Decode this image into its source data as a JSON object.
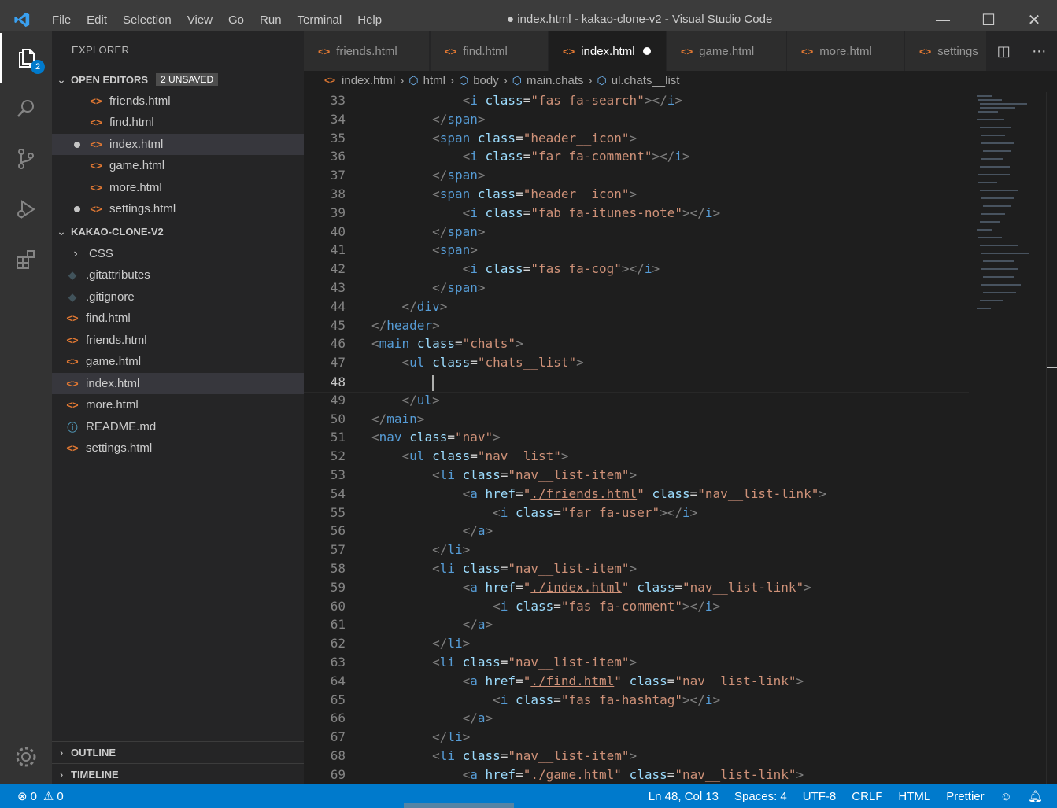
{
  "menu": [
    "File",
    "Edit",
    "Selection",
    "View",
    "Go",
    "Run",
    "Terminal",
    "Help"
  ],
  "window_title": "● index.html - kakao-clone-v2 - Visual Studio Code",
  "window_controls": {
    "minimize": "—",
    "maximize": "☐",
    "close": "✕"
  },
  "activity": {
    "explorer_badge": "2"
  },
  "explorer": {
    "title": "EXPLORER",
    "open_editors": {
      "label": "OPEN EDITORS",
      "badge": "2 UNSAVED",
      "files": [
        "friends.html",
        "find.html",
        "index.html",
        "game.html",
        "more.html",
        "settings.html"
      ]
    },
    "project": {
      "label": "KAKAO-CLONE-V2",
      "items": [
        "CSS",
        ".gitattributes",
        ".gitignore",
        "find.html",
        "friends.html",
        "game.html",
        "index.html",
        "more.html",
        "README.md",
        "settings.html"
      ]
    },
    "outline": "OUTLINE",
    "timeline": "TIMELINE"
  },
  "tabs": [
    "friends.html",
    "find.html",
    "index.html",
    "game.html",
    "more.html",
    "settings"
  ],
  "breadcrumb": [
    "index.html",
    "html",
    "body",
    "main.chats",
    "ul.chats__list"
  ],
  "status": {
    "errors": "0",
    "warnings": "0",
    "position": "Ln 48, Col 13",
    "spaces": "Spaces: 4",
    "encoding": "UTF-8",
    "eol": "CRLF",
    "language": "HTML",
    "formatter": "Prettier"
  },
  "code": {
    "line_numbers": [
      "33",
      "34",
      "35",
      "36",
      "37",
      "38",
      "39",
      "40",
      "41",
      "42",
      "43",
      "44",
      "45",
      "46",
      "47",
      "48",
      "49",
      "50",
      "51",
      "52",
      "53",
      "54",
      "55",
      "56",
      "57",
      "58",
      "59",
      "60",
      "61",
      "62",
      "63",
      "64",
      "65",
      "66",
      "67",
      "68",
      "69"
    ],
    "strings": {
      "fa_search": "\"fas fa-search\"",
      "header_icon": "\"header__icon\"",
      "fa_comment_far": "\"far fa-comment\"",
      "fa_itunes": "\"fab fa-itunes-note\"",
      "fa_cog": "\"fas fa-cog\"",
      "chats": "\"chats\"",
      "chats_list": "\"chats__list\"",
      "nav": "\"nav\"",
      "nav_list": "\"nav__list\"",
      "nav_list_item": "\"nav__list-item\"",
      "nav_list_link": "\"nav__list-link\"",
      "href_friends": "./friends.html",
      "href_index": "./index.html",
      "href_find": "./find.html",
      "href_game": "./game.html",
      "fa_user": "\"far fa-user\"",
      "fa_comment_fas": "\"fas fa-comment\"",
      "fa_hashtag": "\"fas fa-hashtag\""
    }
  }
}
